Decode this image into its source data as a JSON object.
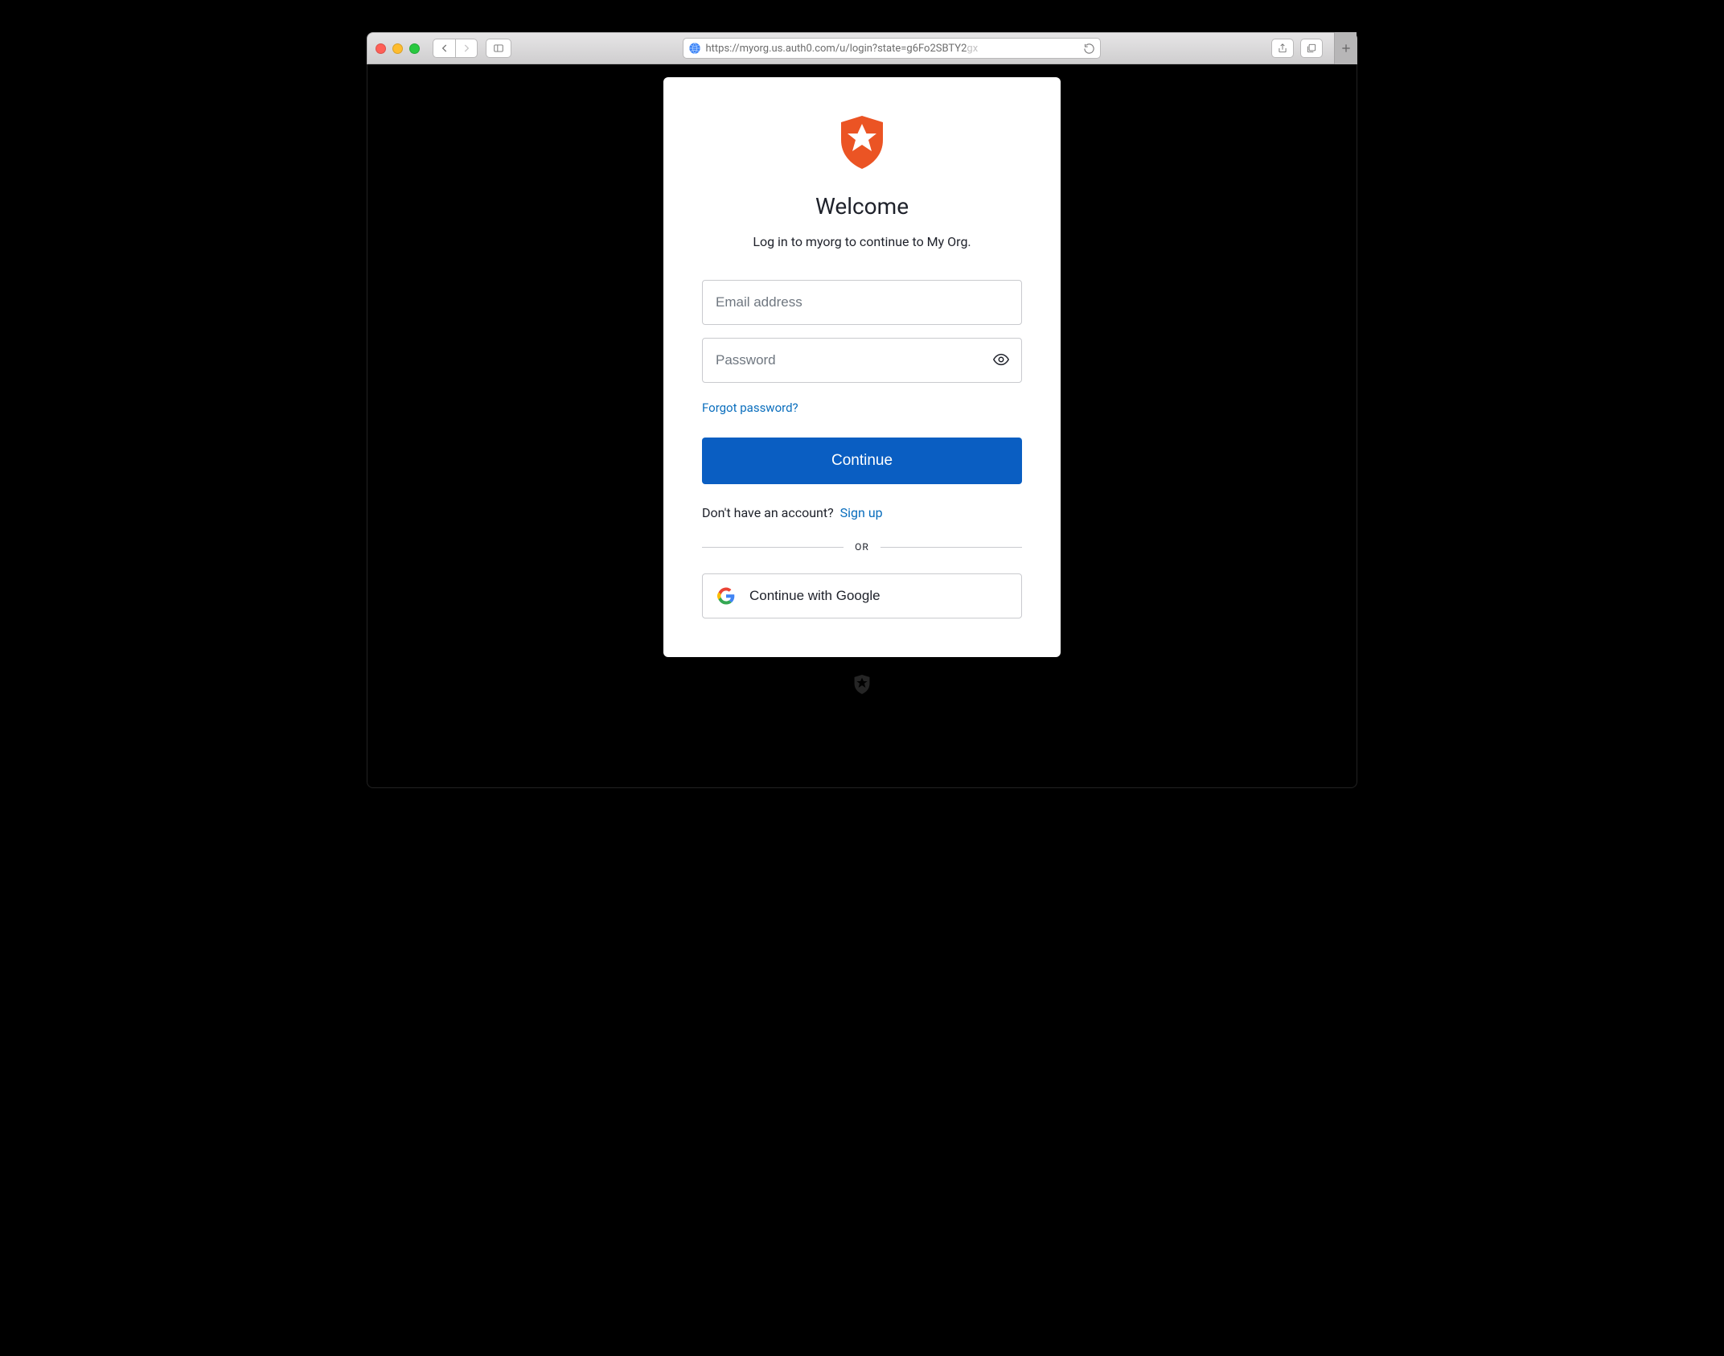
{
  "browser": {
    "url_full": "https://myorg.us.auth0.com/u/login?state=g6Fo2SBTY2gx",
    "url_dark": "https://myorg.us.auth0.com/u/login?state=g6Fo2SBTY2",
    "url_faded": "gx"
  },
  "login": {
    "title": "Welcome",
    "subtitle": "Log in to myorg to continue to My Org.",
    "email_placeholder": "Email address",
    "password_placeholder": "Password",
    "forgot_label": "Forgot password?",
    "continue_label": "Continue",
    "signup_prompt": "Don't have an account?",
    "signup_link": "Sign up",
    "divider_label": "OR",
    "google_label": "Continue with Google"
  },
  "colors": {
    "brand": "#eb5424",
    "primary": "#0a5ec2",
    "link": "#0a6ebd"
  }
}
